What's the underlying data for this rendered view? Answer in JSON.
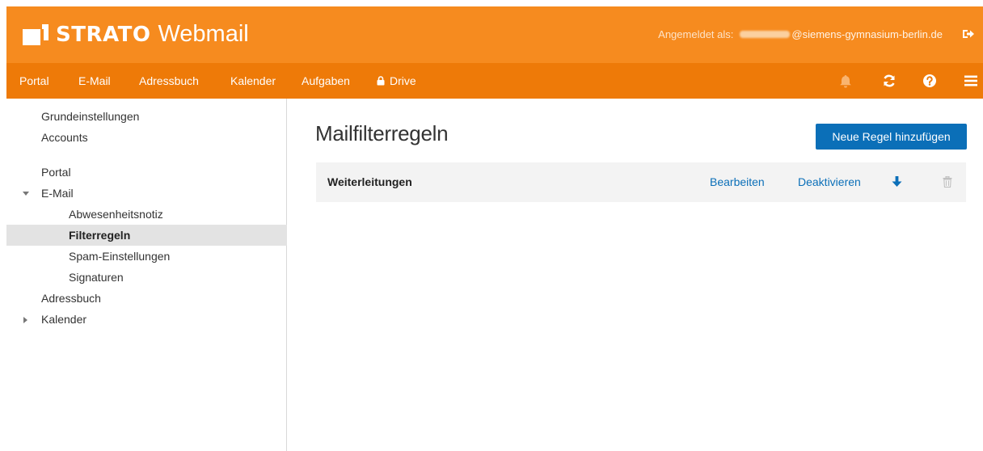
{
  "header": {
    "brand": "STRATO",
    "product": "Webmail",
    "user_label": "Angemeldet als:",
    "user_email_suffix": "@siemens-gymnasium-berlin.de",
    "logout_icon": "logout-icon",
    "bg_color": "#f68b1f"
  },
  "nav": {
    "items": [
      {
        "label": "Portal"
      },
      {
        "label": "E-Mail"
      },
      {
        "label": "Adressbuch"
      },
      {
        "label": "Kalender"
      },
      {
        "label": "Aufgaben"
      },
      {
        "label": "Drive",
        "icon": "lock-icon"
      }
    ],
    "tools": [
      "bell-icon",
      "refresh-icon",
      "help-icon",
      "menu-icon"
    ],
    "bg_color": "#ee7a08"
  },
  "sidebar": {
    "items": [
      {
        "label": "Grundeinstellungen"
      },
      {
        "label": "Accounts"
      },
      {
        "label": "Portal"
      },
      {
        "label": "E-Mail",
        "expanded": true
      },
      {
        "label": "Abwesenheitsnotiz"
      },
      {
        "label": "Filterregeln",
        "active": true
      },
      {
        "label": "Spam-Einstellungen"
      },
      {
        "label": "Signaturen"
      },
      {
        "label": "Adressbuch"
      },
      {
        "label": "Kalender",
        "expanded": false
      }
    ]
  },
  "main": {
    "title": "Mailfilterregeln",
    "add_button": "Neue Regel hinzufügen",
    "rules": [
      {
        "name": "Weiterleitungen",
        "edit": "Bearbeiten",
        "deactivate": "Deaktivieren",
        "move_icon": "arrow-down-icon",
        "delete_icon": "trash-icon"
      }
    ],
    "accent_color": "#0b6fb8"
  }
}
